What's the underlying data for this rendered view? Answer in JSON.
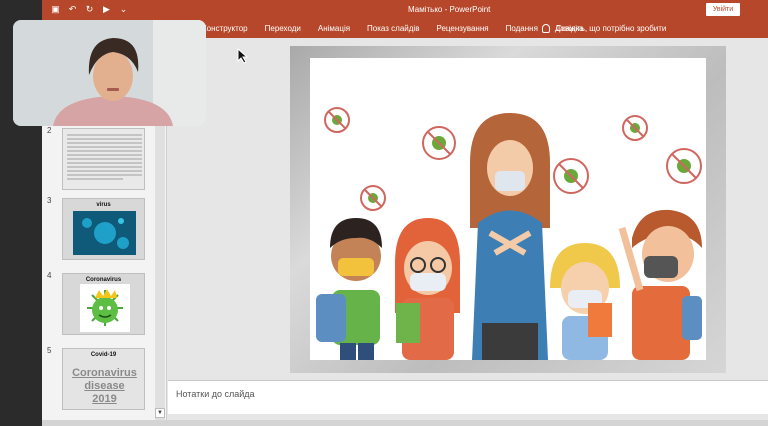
{
  "window": {
    "title": "Мамітько - PowerPoint",
    "login_button": "Увійти"
  },
  "ribbon": {
    "tabs": [
      "Конструктор",
      "Переходи",
      "Анімація",
      "Показ слайдів",
      "Рецензування",
      "Подання",
      "Довідка"
    ],
    "tell_me": "Скажіть, що потрібно зробити"
  },
  "slides": [
    {
      "number": "2",
      "title": ""
    },
    {
      "number": "3",
      "title": "virus"
    },
    {
      "number": "4",
      "title": "Coronavirus"
    },
    {
      "number": "5",
      "title": "Covid-19",
      "body": "Coronavirus disease 2019"
    }
  ],
  "notes_placeholder": "Нотатки до слайда",
  "colors": {
    "accent": "#b7472a"
  }
}
